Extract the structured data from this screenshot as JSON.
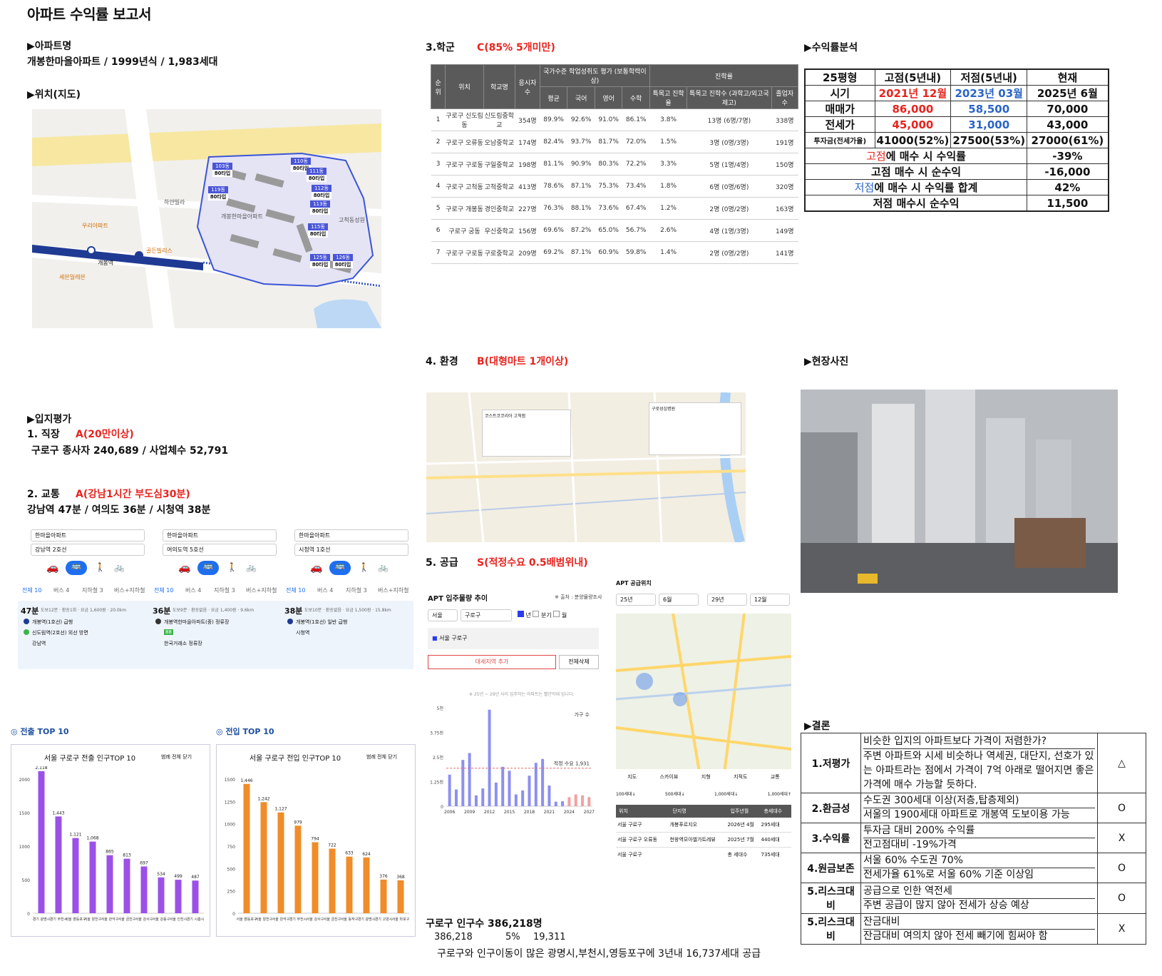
{
  "title": "아파트 수익률 보고서",
  "apt": {
    "heading": "▶아파트명",
    "value": "개봉한마을아파트 / 1999년식 / 1,983세대"
  },
  "loc": {
    "heading": "▶위치(지도)",
    "stations": [
      "개봉역"
    ],
    "map_labels": [
      "고척동성원",
      "개봉한마을아파트",
      "세븐일레븐",
      "골든빌리스",
      "우리아파트",
      "하얀빌라"
    ],
    "dong_labels": [
      "103동",
      "110동",
      "111동",
      "112동",
      "113동",
      "115동",
      "119동",
      "125동",
      "126동"
    ],
    "type_label": "80타입"
  },
  "eval": {
    "heading": "▶입지평가",
    "job_label": "1. 직장",
    "job_grade": "A(20만이상)",
    "job_text": "구로구 종사자 240,689 / 사업체수 52,791",
    "traffic_label": "2. 교통",
    "traffic_grade": "A(강남1시간 부도심30분)",
    "traffic_text": "강남역 47분 / 여의도 36분 / 시청역 38분"
  },
  "routes": [
    {
      "from": "한마을아파트",
      "to": "강남역 2호선",
      "time": "47분",
      "detail": "도보12분 · 환승1회 · 요금 1,600원 · 20.0km",
      "steps": [
        "개봉역(1호선) 급행",
        "신도림역(2호선) 외선 방면",
        "강남역"
      ]
    },
    {
      "from": "한마을아파트",
      "to": "여의도역 5호선",
      "time": "36분",
      "detail": "도보9분 · 환승없음 · 요금 1,400원 · 9.6km",
      "steps": [
        "개봉역한마을아파트(중) 정류장",
        "88",
        "한국거래소 정류장"
      ]
    },
    {
      "from": "한마을아파트",
      "to": "시청역 1호선",
      "time": "38분",
      "detail": "도보10분 · 환승없음 · 요금 1,500원 · 15.8km",
      "steps": [
        "개봉역(1호선) 일반 급행",
        "시청역"
      ]
    }
  ],
  "route_tabs": [
    "전체 10",
    "버스 4",
    "지하철 3",
    "버스+지하철"
  ],
  "outflow": {
    "tag": "전출 TOP 10",
    "title": "서울 구로구 전출 인구TOP 10",
    "menu": "범례 전체 닫기"
  },
  "inflow": {
    "tag": "전입 TOP 10",
    "title": "서울 구로구 전입 인구TOP 10",
    "menu": "범례 전체 닫기"
  },
  "chart_data": [
    {
      "type": "bar",
      "title": "서울 구로구 전출 인구TOP 10",
      "categories": [
        "경기 광명시",
        "경기 부천시",
        "서울 영등포구",
        "서울 양천구",
        "서울 관악구",
        "서울 금천구",
        "서울 강서구",
        "서울 강동구",
        "서울 인천시",
        "경기 시흥시"
      ],
      "values": [
        2118,
        1443,
        1121,
        1068,
        865,
        813,
        697,
        534,
        499,
        487
      ],
      "ylim": [
        0,
        2000
      ],
      "yticks": [
        "0",
        "500",
        "1000",
        "1500",
        "2000"
      ],
      "color": "#9b51e8"
    },
    {
      "type": "bar",
      "title": "서울 구로구 전입 인구TOP 10",
      "categories": [
        "서울 영등포구",
        "서울 양천구",
        "서울 관악구",
        "경기 부천시",
        "서울 강서구",
        "서울 금천구",
        "서울 동작구",
        "경기 광명시",
        "경기 고양시",
        "서울 마포구"
      ],
      "values": [
        1446,
        1242,
        1127,
        979,
        794,
        722,
        633,
        624,
        376,
        368
      ],
      "ylim": [
        0,
        1500
      ],
      "yticks": [
        "0",
        "250",
        "500",
        "750",
        "1000",
        "1250",
        "1500"
      ],
      "color": "#f08c2a"
    },
    {
      "type": "bar",
      "title": "APT 입주물량 추이",
      "categories": [
        "2006",
        "2007",
        "2008",
        "2009",
        "2010",
        "2011",
        "2012",
        "2013",
        "2014",
        "2015",
        "2016",
        "2017",
        "2018",
        "2019",
        "2020",
        "2021",
        "2022",
        "2023",
        "2024",
        "2025",
        "2026",
        "2027"
      ],
      "values": [
        1600,
        850,
        2350,
        2700,
        550,
        900,
        4900,
        1200,
        2000,
        1800,
        600,
        800,
        1550,
        2200,
        2400,
        1050,
        230,
        250,
        460,
        600,
        550,
        460
      ],
      "ylim": [
        0,
        5000
      ],
      "yticks": [
        "0",
        "1.25천",
        "2.5천",
        "3.75천",
        "5천"
      ],
      "threshold": 1931,
      "threshold_label": "적정 수요 1,931",
      "legend": "가구 수"
    }
  ],
  "school": {
    "heading": "3.학군",
    "grade": "C(85% 5개미만)",
    "cols": [
      "순위",
      "위치",
      "학교명",
      "응시자수",
      "평균",
      "국어",
      "영어",
      "수학",
      "특목고 진학율",
      "특목고 진학수 (과학고/외고국제고)",
      "졸업자 수"
    ],
    "group1": "국가수준 학업성취도 평가 (보통학력이상)",
    "group2": "진학률",
    "rows": [
      [
        "1",
        "구로구 신도림동",
        "신도림중학교",
        "354명",
        "89.9%",
        "92.6%",
        "91.0%",
        "86.1%",
        "3.8%",
        "13명 (6명/7명)",
        "338명"
      ],
      [
        "2",
        "구로구 오류동",
        "오남중학교",
        "174명",
        "82.4%",
        "93.7%",
        "81.7%",
        "72.0%",
        "1.5%",
        "3명 (0명/3명)",
        "191명"
      ],
      [
        "3",
        "구로구 구로동",
        "구일중학교",
        "198명",
        "81.1%",
        "90.9%",
        "80.3%",
        "72.2%",
        "3.3%",
        "5명 (1명/4명)",
        "150명"
      ],
      [
        "4",
        "구로구 고척동",
        "고척중학교",
        "413명",
        "78.6%",
        "87.1%",
        "75.3%",
        "73.4%",
        "1.8%",
        "6명 (0명/6명)",
        "320명"
      ],
      [
        "5",
        "구로구 개봉동",
        "경인중학교",
        "227명",
        "76.3%",
        "88.1%",
        "73.6%",
        "67.4%",
        "1.2%",
        "2명 (0명/2명)",
        "163명"
      ],
      [
        "6",
        "구로구 궁동",
        "우신중학교",
        "156명",
        "69.6%",
        "87.2%",
        "65.0%",
        "56.7%",
        "2.6%",
        "4명 (1명/3명)",
        "149명"
      ],
      [
        "7",
        "구로구 구로동",
        "구로중학교",
        "209명",
        "69.2%",
        "87.1%",
        "60.9%",
        "59.8%",
        "1.4%",
        "2명 (0명/2명)",
        "141명"
      ]
    ]
  },
  "env": {
    "heading": "4. 환경",
    "grade": "B(대형마트 1개이상)",
    "popup1": "코스트코코리아 고척점",
    "popup2": "구로성심병원"
  },
  "supply": {
    "heading": "5. 공급",
    "grade": "S(적정수요 0.5배범위내)",
    "chart_title": "APT 입주물량 추이",
    "source": "※ 출처 : 분양물량조사",
    "sel1": "서울",
    "sel2": "구로구",
    "tabs": [
      "년",
      "분기",
      "월"
    ],
    "region": "서울 구로구",
    "add_btn": "대세지역 추가",
    "del_btn": "전체삭제",
    "note": "※ 25년 ~ 29년 사이 입주하는 아파트는 빨간막대 입니다.",
    "loc_title": "APT 공급위치",
    "loc_selects": [
      "25년",
      "6월",
      "29년",
      "12월"
    ],
    "map_tabs": [
      "지도",
      "스카이뷰",
      "지형",
      "지적도",
      "교통"
    ],
    "legend": [
      "100세대↓",
      "500세대↓",
      "1,000세대↓",
      "1,000세대↑"
    ],
    "table_cols": [
      "위치",
      "단지명",
      "입주년월",
      "총세대수"
    ],
    "table_rows": [
      [
        "서울 구로구",
        "개봉푸르지오",
        "2026년 4월",
        "295세대"
      ],
      [
        "서울 구로구 오류동",
        "천왕역모아엘가트레뷰",
        "2025년 7월",
        "440세대"
      ],
      [
        "서울 구로구",
        "",
        "총 세대수",
        "735세대"
      ]
    ]
  },
  "pop": {
    "line1": "구로구 인구수 386,218명",
    "n1": "386,218",
    "n2": "5%",
    "n3": "19,311",
    "line3": "구로구와 인구이동이 많은 광명시,부천시,영등포구에 3년내 16,737세대 공급"
  },
  "profit": {
    "heading": "▶수익률분석",
    "head": [
      "25평형",
      "고점(5년내)",
      "저점(5년내)",
      "현재"
    ],
    "period": [
      "시기",
      "2021년 12월",
      "2023년 03월",
      "2025년 6월"
    ],
    "sale": [
      "매매가",
      "86,000",
      "58,500",
      "70,000"
    ],
    "jeonse": [
      "전세가",
      "45,000",
      "31,000",
      "43,000"
    ],
    "invest": [
      "투자금(전세가율)",
      "41000(52%)",
      "27500(53%)",
      "27000(61%)"
    ],
    "r1": {
      "hl": "고점",
      "rest": "에 매수 시 수익률",
      "v": "-39%"
    },
    "r2": {
      "label": "고점 매수 시 순수익",
      "v": "-16,000"
    },
    "r3": {
      "hl": "저점",
      "rest": "에 매수 시 수익률 합계",
      "v": "42%"
    },
    "r4": {
      "label": "저점 매수시 순수익",
      "v": "11,500"
    }
  },
  "photo": {
    "heading": "▶현장사진"
  },
  "conclusion": {
    "heading": "▶결론",
    "rows": [
      {
        "k": "1.저평가",
        "lines": [
          "비슷한 입지의 아파트보다 가격이 저렴한가?",
          "주변 아파트와 시세 비슷하나 역세권, 대단지, 선호가 있는 아파트라는 점에서 가격이 7억 아래로 떨어지면 좋은 가격에 매수 가능할 듯하다."
        ],
        "m": "△"
      },
      {
        "k": "2.환금성",
        "lines": [
          "수도권 300세대 이상(저층,탑층제외)",
          "서울의 1900세대 아파트로 개봉역 도보이용 가능"
        ],
        "m": "O"
      },
      {
        "k": "3.수익률",
        "lines": [
          "투자금 대비 200% 수익률",
          "전고점대비 -19%가격"
        ],
        "m": "X"
      },
      {
        "k": "4.원금보존",
        "lines": [
          "서울 60% 수도권 70%",
          "전세가율 61%로 서울 60% 기준 이상임"
        ],
        "m": "O"
      },
      {
        "k": "5.리스크대비",
        "lines": [
          "공급으로 인한 역전세",
          "주변 공급이 많지 않아 전세가 상승 예상"
        ],
        "m": "O"
      },
      {
        "k": "5.리스크대비",
        "lines": [
          "잔금대비",
          "잔금대비 여의치 않아 전세 빼기에 힘써야 함"
        ],
        "m": "X"
      }
    ]
  }
}
